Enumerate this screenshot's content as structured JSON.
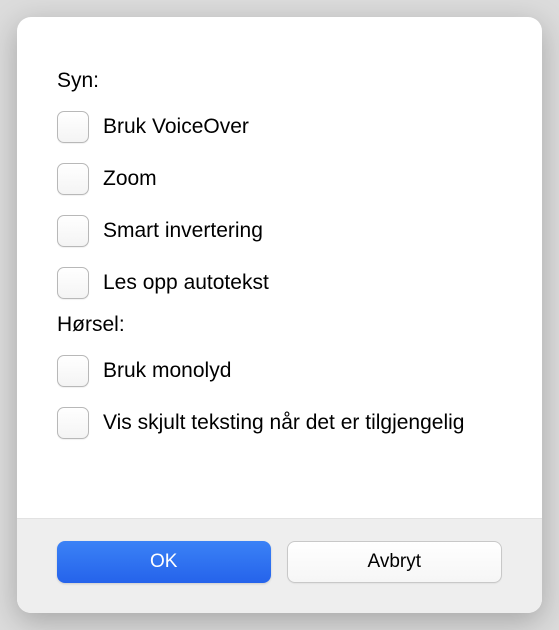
{
  "sections": {
    "vision_heading": "Syn:",
    "hearing_heading": "Hørsel:"
  },
  "options": {
    "voiceover": "Bruk VoiceOver",
    "zoom": "Zoom",
    "smart_invert": "Smart invertering",
    "speak_autotext": "Les opp autotekst",
    "mono_audio": "Bruk monolyd",
    "closed_captions": "Vis skjult teksting når det er tilgjengelig"
  },
  "buttons": {
    "ok": "OK",
    "cancel": "Avbryt"
  }
}
